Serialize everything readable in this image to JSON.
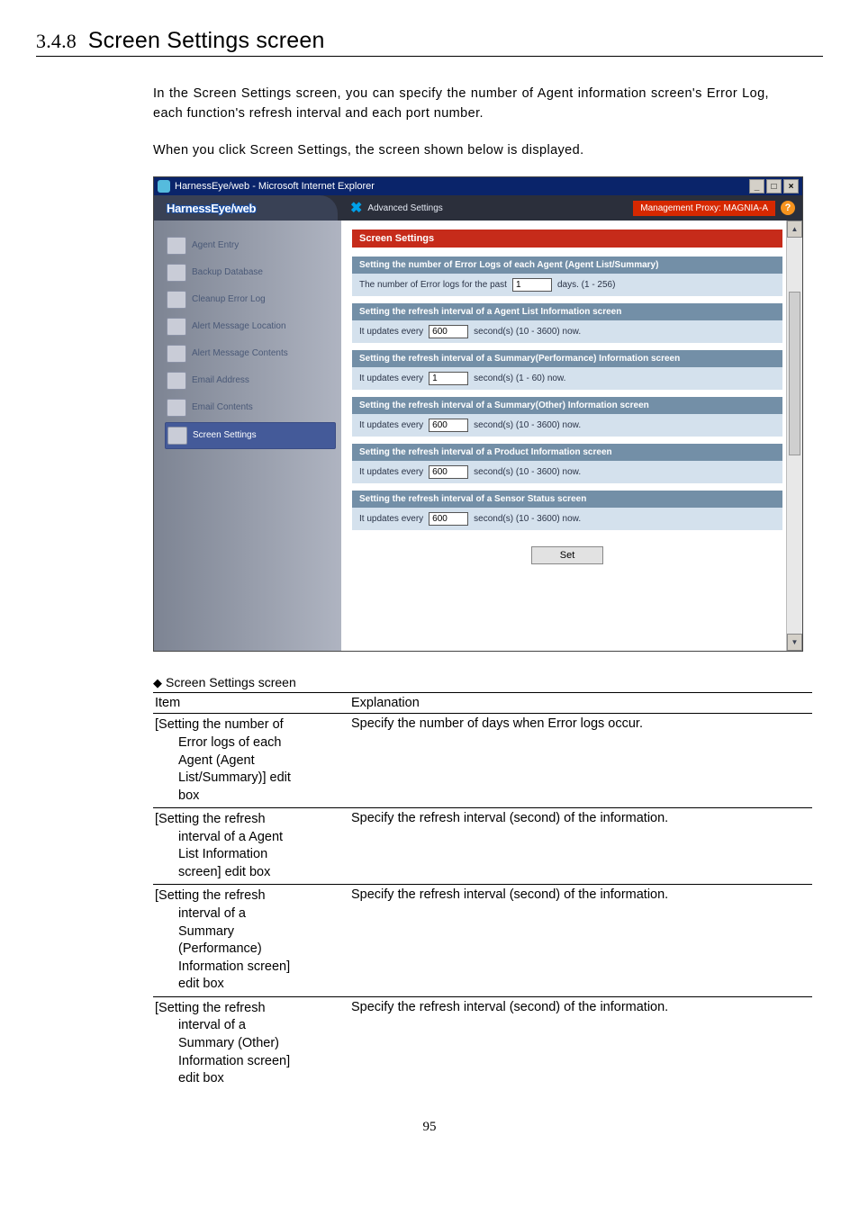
{
  "heading_num": "3.4.8",
  "heading_title": "Screen Settings screen",
  "intro_p1": "In the Screen Settings screen, you can specify the number of Agent information screen's Error Log, each function's refresh interval and each port number.",
  "intro_p2": "When you click Screen Settings, the screen shown below is displayed.",
  "window": {
    "title": "HarnessEye/web - Microsoft Internet Explorer",
    "min_glyph": "_",
    "max_glyph": "□",
    "close_glyph": "×",
    "logo": "HarnessEye/web",
    "adv_label": "Advanced Settings",
    "proxy_label": "Management Proxy: MAGNIA-A",
    "help_glyph": "?",
    "up_glyph": "▲",
    "down_glyph": "▼"
  },
  "nav": {
    "i0": "Agent Entry",
    "i1": "Backup Database",
    "i2": "Cleanup Error Log",
    "i3": "Alert Message Location",
    "i4": "Alert Message Contents",
    "i5": "Email Address",
    "i6": "Email Contents",
    "i7": "Screen Settings"
  },
  "panel": {
    "title": "Screen Settings",
    "s1_bar": "Setting the number of Error Logs of each Agent (Agent List/Summary)",
    "s1_pre": "The number of Error logs for the past",
    "s1_val": "1",
    "s1_post": "days. (1 - 256)",
    "s2_bar": "Setting the refresh interval of a Agent List Information screen",
    "s2_pre": "It updates every",
    "s2_val": "600",
    "s2_post": "second(s) (10 - 3600) now.",
    "s3_bar": "Setting the refresh interval of a Summary(Performance) Information screen",
    "s3_pre": "It updates every",
    "s3_val": "1",
    "s3_post": "second(s) (1 - 60) now.",
    "s4_bar": "Setting the refresh interval of a Summary(Other) Information screen",
    "s4_pre": "It updates every",
    "s4_val": "600",
    "s4_post": "second(s) (10 - 3600) now.",
    "s5_bar": "Setting the refresh interval of a Product Information screen",
    "s5_pre": "It updates every",
    "s5_val": "600",
    "s5_post": "second(s) (10 - 3600) now.",
    "s6_bar": "Setting the refresh interval of a Sensor Status screen",
    "s6_pre": "It updates every",
    "s6_val": "600",
    "s6_post": "second(s) (10 - 3600) now.",
    "set_btn": "Set"
  },
  "table_caption": "Screen Settings screen",
  "th_item": "Item",
  "th_expl": "Explanation",
  "rows": {
    "r1_i_l1": "[Setting the number of",
    "r1_i_l2": "Error logs of each",
    "r1_i_l3": "Agent (Agent",
    "r1_i_l4": "List/Summary)] edit",
    "r1_i_l5": "box",
    "r1_e": "Specify the number of days when Error logs occur.",
    "r2_i_l1": "[Setting the refresh",
    "r2_i_l2": "interval of a Agent",
    "r2_i_l3": "List Information",
    "r2_i_l4": "screen] edit box",
    "r2_e": "Specify the refresh interval (second) of the information.",
    "r3_i_l1": "[Setting the refresh",
    "r3_i_l2": "interval of a",
    "r3_i_l3": "Summary",
    "r3_i_l4": "(Performance)",
    "r3_i_l5": "Information screen]",
    "r3_i_l6": "edit box",
    "r3_e": "Specify the refresh interval (second) of the information.",
    "r4_i_l1": "[Setting the refresh",
    "r4_i_l2": "interval of a",
    "r4_i_l3": "Summary (Other)",
    "r4_i_l4": "Information screen]",
    "r4_i_l5": "edit box",
    "r4_e": "Specify the refresh interval (second) of the information."
  },
  "page_number": "95"
}
